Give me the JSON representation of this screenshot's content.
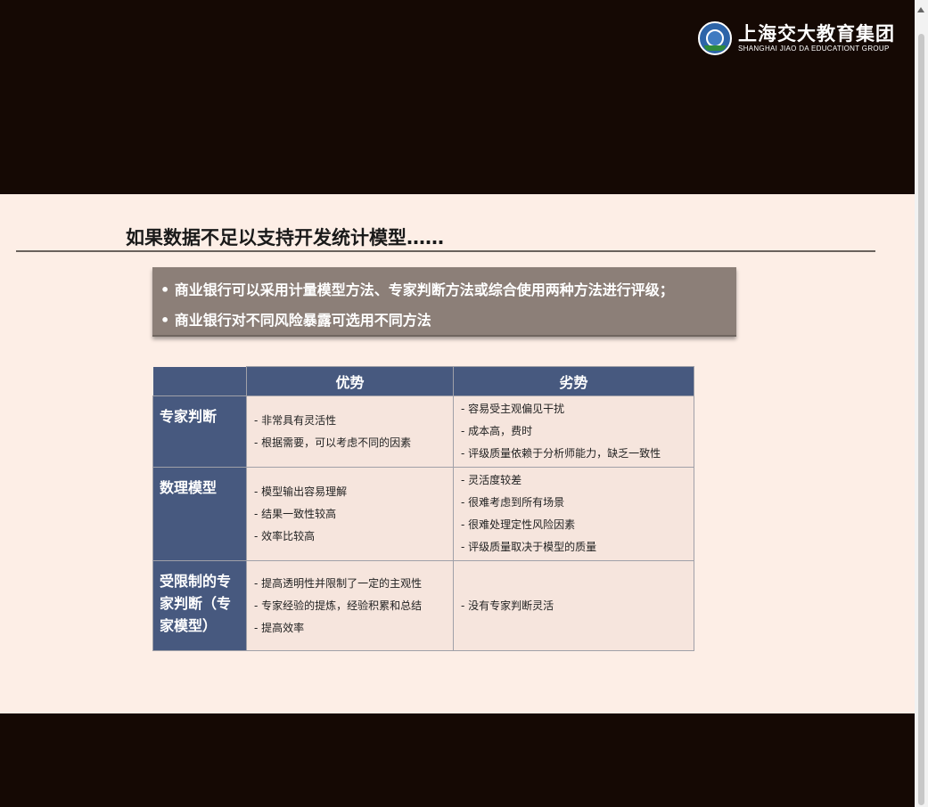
{
  "logo": {
    "name_cn": "上海交大教育集团",
    "name_en": "SHANGHAI JIAO DA EDUCATIONT GROUP",
    "emblem_icon": "university-emblem-icon"
  },
  "slide": {
    "title": "如果数据不足以支持开发统计模型……",
    "callout_bullets": [
      "• 商业银行可以采用计量模型方法、专家判断方法或综合使用两种方法进行评级；",
      "• 商业银行对不同风险暴露可选用不同方法"
    ],
    "table": {
      "headers": [
        "优势",
        "劣势"
      ],
      "rows": [
        {
          "label": "专家判断",
          "pros": [
            "非常具有灵活性",
            "根据需要，可以考虑不同的因素"
          ],
          "cons": [
            "容易受主观偏见干扰",
            "成本高，费时",
            "评级质量依赖于分析师能力，缺乏一致性"
          ]
        },
        {
          "label": "数理模型",
          "pros": [
            "模型输出容易理解",
            "结果一致性较高",
            "效率比较高"
          ],
          "cons": [
            "灵活度较差",
            "很难考虑到所有场景",
            "很难处理定性风险因素",
            "评级质量取决于模型的质量"
          ]
        },
        {
          "label": "受限制的专家判断（专家模型）",
          "pros": [
            "提高透明性并限制了一定的主观性",
            "专家经验的提炼，经验积累和总结",
            "提高效率"
          ],
          "cons": [
            "没有专家判断灵活"
          ]
        }
      ]
    }
  },
  "colors": {
    "video_background": "#150904",
    "slide_background": "#fdeee6",
    "table_header": "#47597f",
    "callout": "#8c7f78"
  }
}
